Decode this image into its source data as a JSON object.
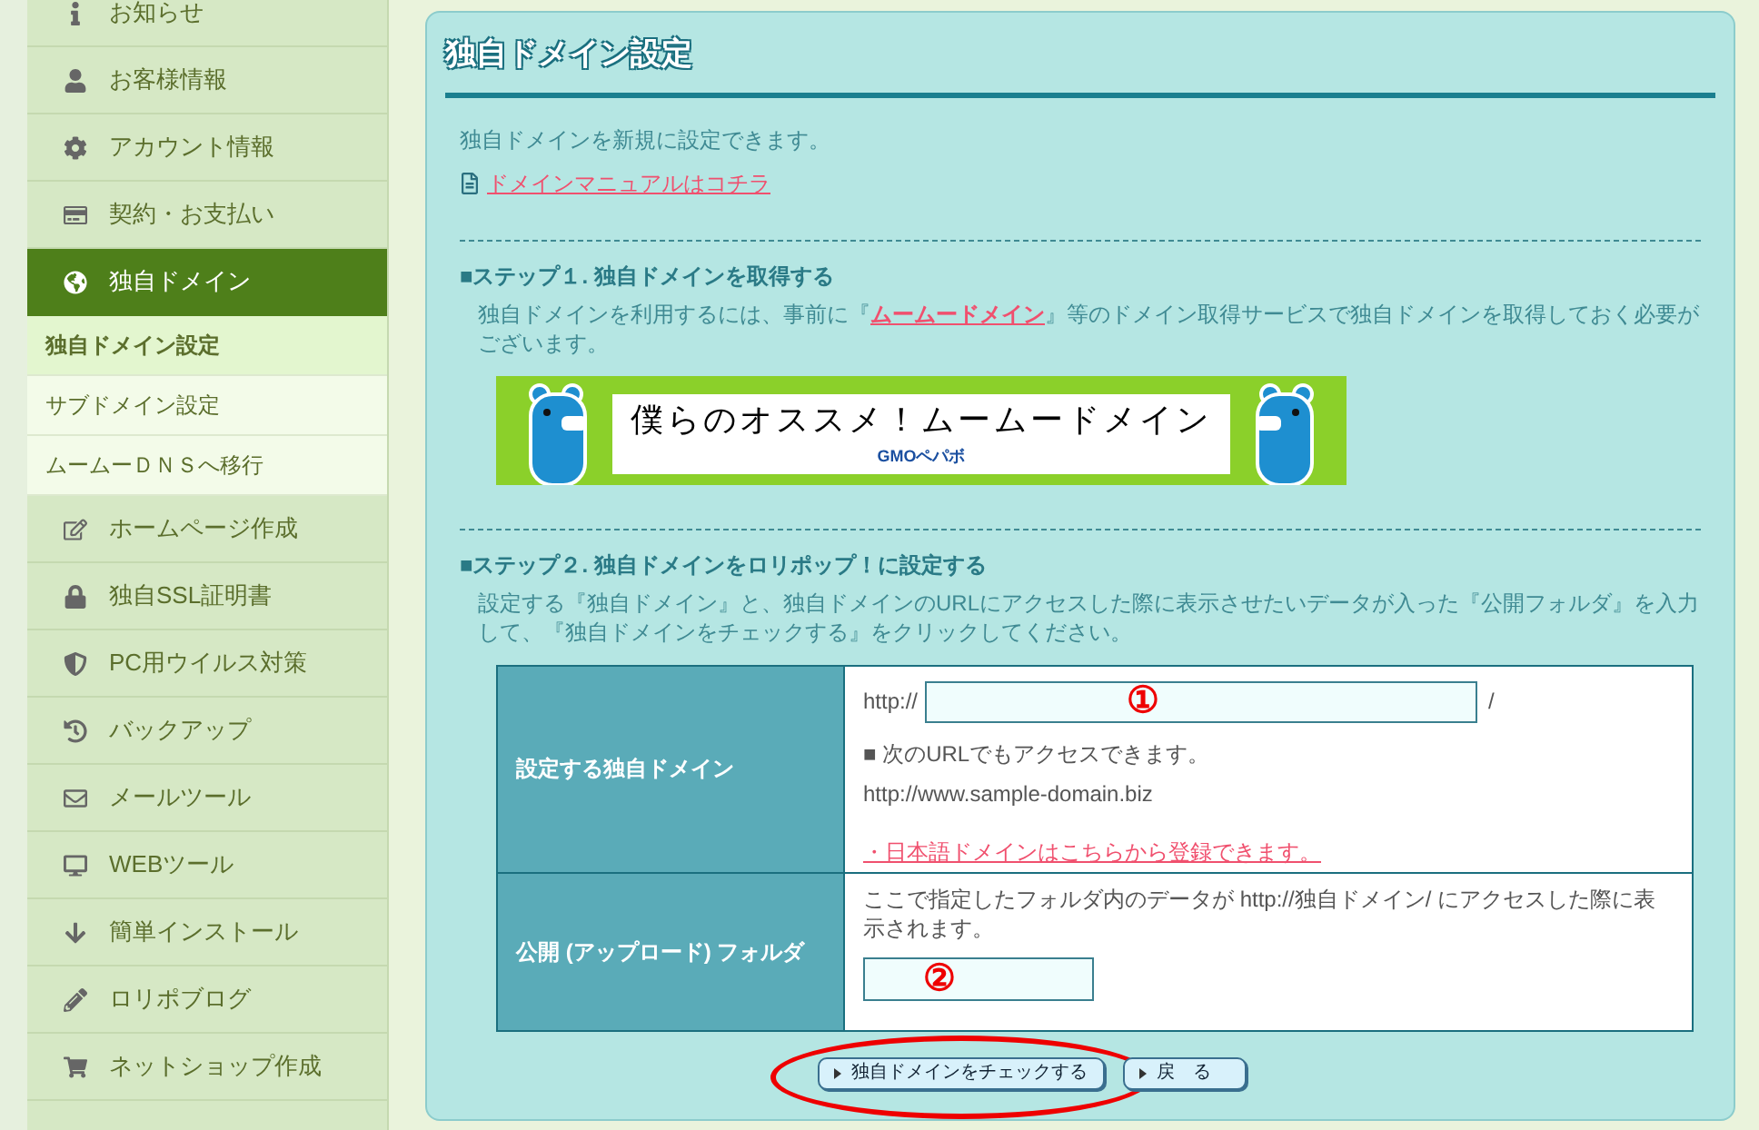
{
  "sidebar": {
    "items": [
      {
        "label": "お知らせ",
        "selected": false
      },
      {
        "label": "お客様情報",
        "selected": false
      },
      {
        "label": "アカウント情報",
        "selected": false
      },
      {
        "label": "契約・お支払い",
        "selected": false
      },
      {
        "label": "独自ドメイン",
        "selected": true,
        "children": [
          {
            "label": "独自ドメイン設定",
            "selected": true
          },
          {
            "label": "サブドメイン設定",
            "selected": false
          },
          {
            "label": "ムームーＤＮＳへ移行",
            "selected": false
          }
        ]
      },
      {
        "label": "ホームページ作成",
        "selected": false
      },
      {
        "label": "独自SSL証明書",
        "selected": false
      },
      {
        "label": "PC用ウイルス対策",
        "selected": false
      },
      {
        "label": "バックアップ",
        "selected": false
      },
      {
        "label": "メールツール",
        "selected": false
      },
      {
        "label": "WEBツール",
        "selected": false
      },
      {
        "label": "簡単インストール",
        "selected": false
      },
      {
        "label": "ロリポブログ",
        "selected": false
      },
      {
        "label": "ネットショップ作成",
        "selected": false
      }
    ]
  },
  "panel": {
    "title": "独自ドメイン設定",
    "intro": "独自ドメインを新規に設定できます。",
    "manual_link": "ドメインマニュアルはコチラ",
    "step1": {
      "heading": "■ステップ１. 独自ドメインを取得する",
      "text_before": "独自ドメインを利用するには、事前に『",
      "link": "ムームードメイン",
      "text_after": "』等のドメイン取得サービスで独自ドメインを取得しておく必要がございます。",
      "banner": {
        "headline": "僕らのオススメ！ムームードメイン",
        "brand": "GMOペパボ"
      }
    },
    "step2": {
      "heading": "■ステップ２. 独自ドメインをロリポップ！に設定する",
      "text": "設定する『独自ドメイン』と、独自ドメインのURLにアクセスした際に表示させたいデータが入った『公開フォルダ』を入力して、『独自ドメインをチェックする』をクリックしてください。"
    },
    "form": {
      "domain": {
        "label": "設定する独自ドメイン",
        "prefix": "http://",
        "suffix": "/",
        "marker": "①",
        "note": "■ 次のURLでもアクセスできます。",
        "example": "http://www.sample-domain.biz",
        "jp_link": "・日本語ドメインはこちらから登録できます。"
      },
      "folder": {
        "label": "公開 (アップロード) フォルダ",
        "text": "ここで指定したフォルダ内のデータが http://独自ドメイン/ にアクセスした際に表示されます。",
        "marker": "②"
      }
    },
    "buttons": [
      {
        "label": "独自ドメインをチェックする",
        "highlighted": true
      },
      {
        "label": "戻　る",
        "highlighted": false
      }
    ]
  }
}
